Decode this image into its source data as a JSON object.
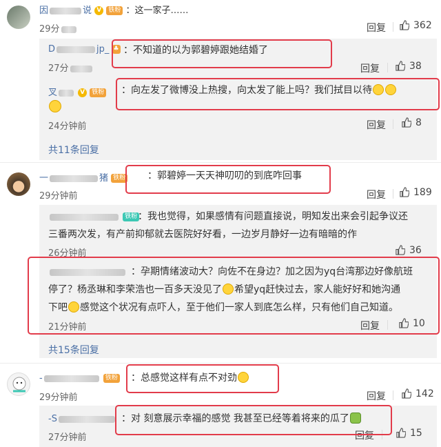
{
  "actions": {
    "reply_label": "回复"
  },
  "comments": [
    {
      "name": "因",
      "name_tail": "说",
      "badge": "铁粉",
      "sep": "：",
      "text": "这一家子……",
      "time": "29分",
      "likes": "362"
    },
    {
      "name": "一",
      "name_tail": "猪",
      "badge": "铁粉",
      "sep": "：",
      "text": "郭碧婷一天天神叨叨的到底咋回事",
      "time": "29分钟前",
      "likes": "189"
    },
    {
      "name": "-",
      "badge": "铁粉",
      "sep": "：",
      "text": "总感觉这样有点不对劲",
      "time": "29分钟前",
      "likes": "142"
    }
  ],
  "replies": [
    {
      "name": "D",
      "name_tail": "jp_",
      "sep": "：",
      "text": "不知道的以为郭碧婷跟她结婚了",
      "time": "27分",
      "likes": "38"
    },
    {
      "name": "叉",
      "badge": "铁粉",
      "sep": "：",
      "text": "向左发了微博没上热搜，向太发了能上吗？我们拭目以待",
      "time": "24分钟前",
      "likes": "8"
    },
    {
      "badge": "铁粉",
      "sep": "：",
      "text": "我也觉得，如果感情有问题直接说，明知发出来会引起争议还",
      "text2": "三番两次发，有产前抑郁就去医院好好看，一边岁月静好一边有暗暗的作",
      "time": "26分钟前",
      "likes": "36"
    },
    {
      "sep": "：",
      "text": "孕期情绪波动大？向佐不在身边？加之因为yq台湾那边好像航班",
      "text2": "停了？杨丞琳和李荣浩也一百多天没见了",
      "text2b": "希望yq赶快过去，家人能好好和她沟通",
      "text3": "下吧",
      "text3b": "感觉这个状况有点吓人，至于他们一家人到底怎么样，只有他们自己知道。",
      "time": "21分钟前",
      "likes": "10"
    },
    {
      "name": "-S",
      "sep": "：",
      "text": "对 刻意展示幸福的感觉 我甚至已经等着将来的瓜了",
      "time": "27分钟前",
      "likes": "15"
    }
  ],
  "more_replies": [
    "共11条回复",
    "共15条回复"
  ]
}
